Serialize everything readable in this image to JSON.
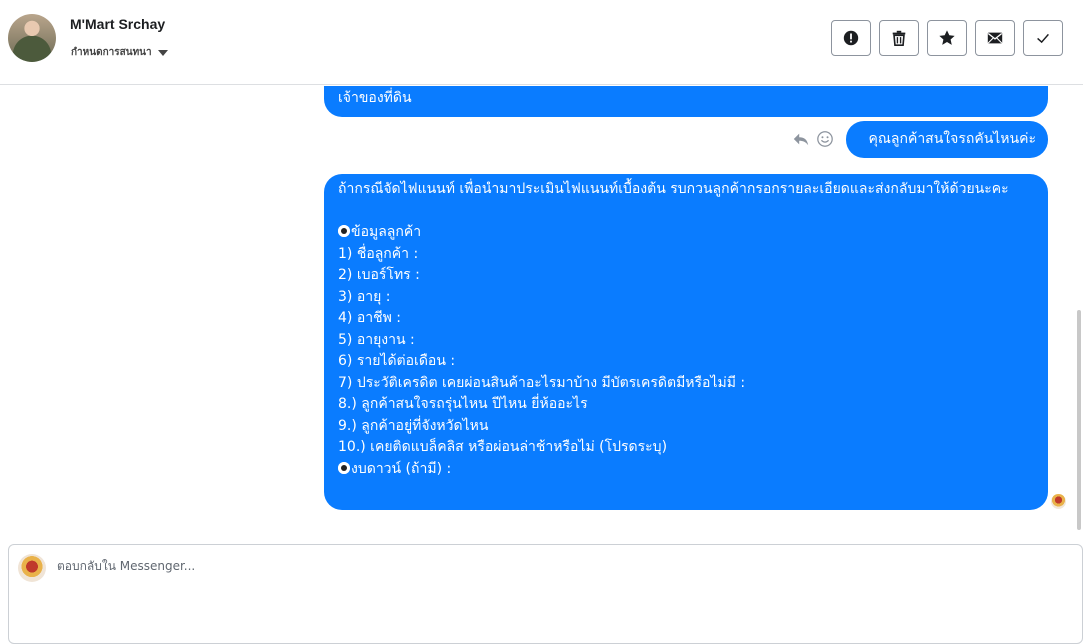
{
  "header": {
    "contact_name": "M'Mart Srchay",
    "assign_label": "กำหนดการสนทนา"
  },
  "toolbar": {
    "buttons": [
      {
        "icon": "alert-icon"
      },
      {
        "icon": "trash-icon"
      },
      {
        "icon": "star-icon"
      },
      {
        "icon": "envelope-icon"
      },
      {
        "icon": "check-icon"
      }
    ]
  },
  "messages": {
    "top_partial": "เจ้าของที่ดิน",
    "question": "คุณลูกค้าสนใจรถคันไหนค่ะ",
    "form_intro": "ถ้ากรณีจัดไฟแนนท์ เพื่อนำมาประเมินไฟแนนท์เบื้องต้น รบกวนลูกค้ากรอกรายละเอียดและส่งกลับมาให้ด้วยนะคะ",
    "form_section": "ข้อมูลลูกค้า",
    "form_items": [
      "1) ชื่อลูกค้า :",
      "2) เบอร์โทร :",
      "3) อายุ :",
      "4) อาชีพ :",
      "5) อายุงาน :",
      "6) รายได้ต่อเดือน :",
      "7) ประวัติเครดิต  เคยผ่อนสินค้าอะไรมาบ้าง มีบัตรเครดิตมีหรือไม่มี :",
      "8.) ลูกค้าสนใจรถรุ่นไหน ปีไหน ยี่ห้ออะไร",
      "9.) ลูกค้าอยู่ที่จังหวัดไหน",
      "10.) เคยติดแบล็คลิส หรือผ่อนล่าช้าหรือไม่ (โปรดระบุ)"
    ],
    "form_downpayment": "งบดาวน์ (ถ้ามี) :"
  },
  "composer": {
    "placeholder": "ตอบกลับใน Messenger..."
  },
  "colors": {
    "bubble": "#0a7cff",
    "border": "#dddfe2"
  }
}
